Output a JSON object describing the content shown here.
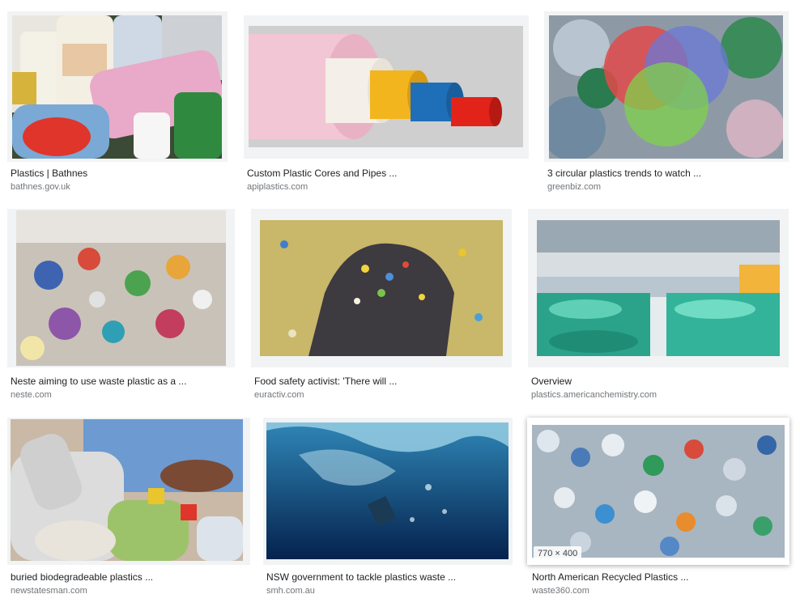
{
  "results": [
    {
      "title": "Plastics | Bathnes",
      "source": "bathnes.gov.uk",
      "icon": "plastic-bottles-image"
    },
    {
      "title": "Custom Plastic Cores and Pipes ...",
      "source": "apiplastics.com",
      "icon": "plastic-pipes-image"
    },
    {
      "title": "3 circular plastics trends to watch ...",
      "source": "greenbiz.com",
      "icon": "circular-plastics-image"
    },
    {
      "title": "Neste aiming to use waste plastic as a ...",
      "source": "neste.com",
      "icon": "waste-plastic-bales-image"
    },
    {
      "title": "Food safety activist: 'There will ...",
      "source": "euractiv.com",
      "icon": "plastic-flakes-glove-image"
    },
    {
      "title": "Overview",
      "source": "plastics.americanchemistry.com",
      "icon": "plastic-containers-conveyor-image"
    },
    {
      "title": "buried biodegradeable plastics ...",
      "source": "newstatesman.com",
      "icon": "sorting-bottles-image"
    },
    {
      "title": "NSW government to tackle plastics waste ...",
      "source": "smh.com.au",
      "icon": "ocean-plastic-image"
    },
    {
      "title": "North American Recycled Plastics ...",
      "source": "waste360.com",
      "icon": "bottle-pile-image",
      "dimensions": "770 × 400"
    }
  ],
  "colors": {
    "title_text": "#202124",
    "source_text": "#70757a",
    "frame_bg": "#f1f3f4"
  }
}
